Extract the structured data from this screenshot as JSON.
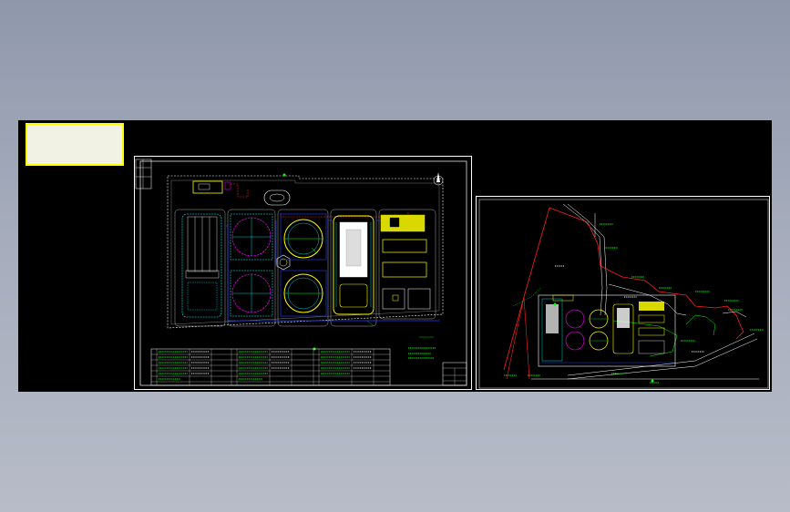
{
  "window": {
    "background_top": "#8f98ab",
    "background_bottom": "#b7bcc8"
  },
  "canvas": {
    "background": "#000000"
  },
  "colors": {
    "green": "#00ff00",
    "cyan": "#00ffff",
    "magenta": "#ff00ff",
    "yellow": "#ffff00",
    "red": "#ff2020",
    "blue": "#2040ff",
    "white": "#ffffff"
  },
  "drawings": {
    "left_sheet": {
      "label": "",
      "north_arrow": "north-arrow-icon"
    },
    "right_sheet": {
      "label": "",
      "compass": ""
    }
  },
  "title_block": {
    "text": ""
  }
}
